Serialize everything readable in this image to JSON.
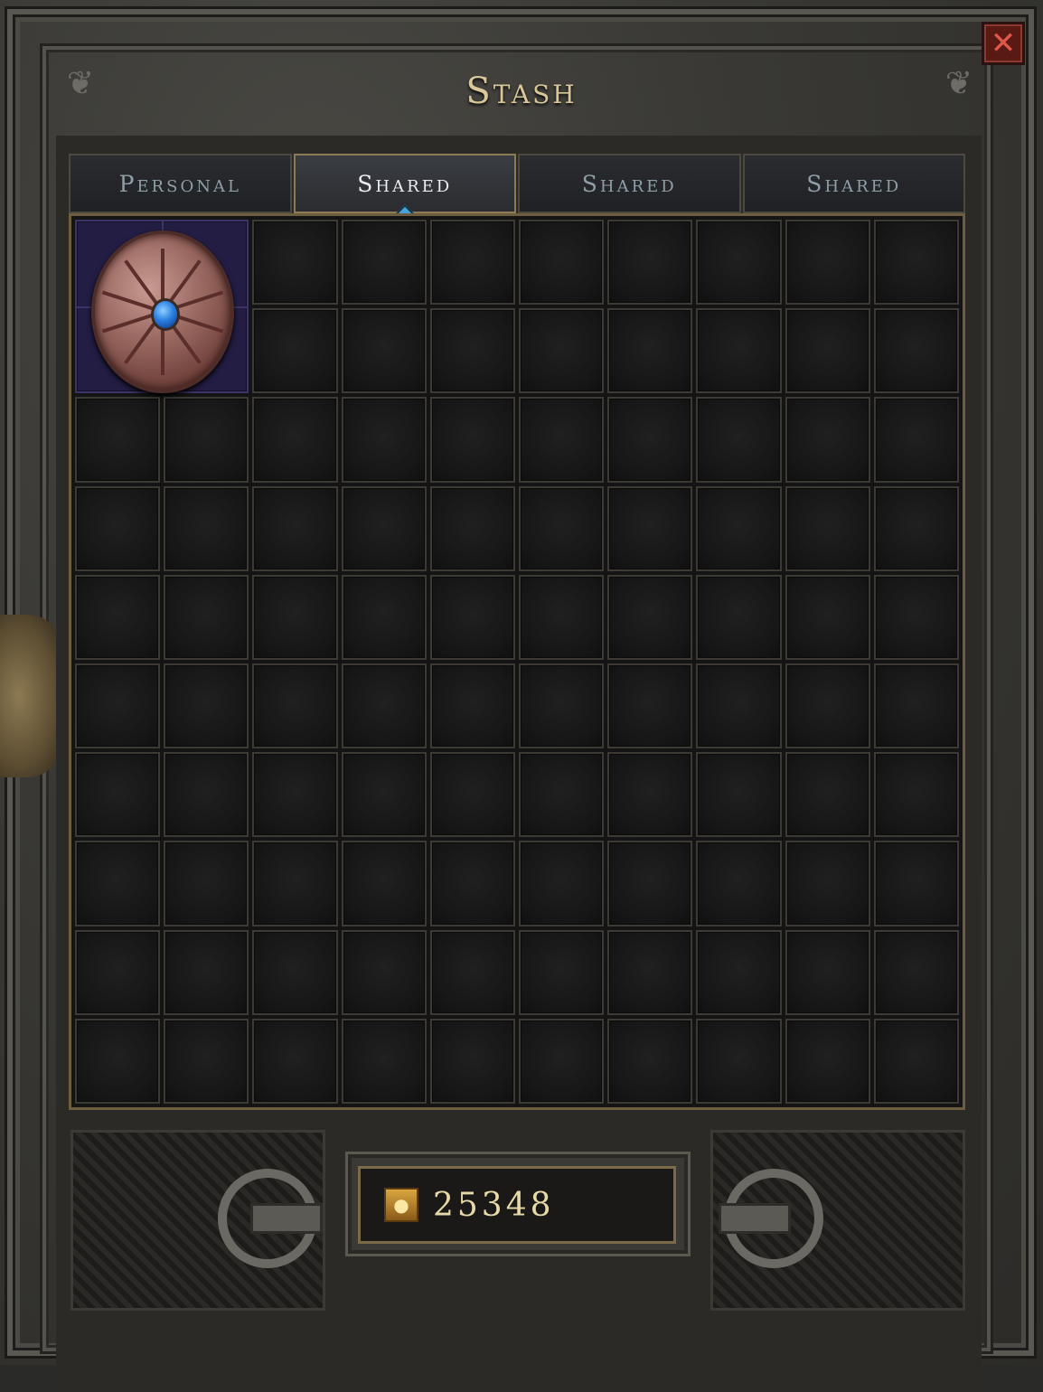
{
  "window": {
    "title": "Stash",
    "close_symbol": "✕"
  },
  "tabs": [
    {
      "label": "Personal",
      "active": false
    },
    {
      "label": "Shared",
      "active": true
    },
    {
      "label": "Shared",
      "active": false
    },
    {
      "label": "Shared",
      "active": false
    }
  ],
  "inventory": {
    "grid_columns": 10,
    "grid_rows": 10,
    "items": [
      {
        "name": "shield",
        "icon": "round-shield-with-blue-gem-icon",
        "column": 1,
        "row": 1,
        "width_cells": 2,
        "height_cells": 2,
        "border_color": "#3c3468"
      }
    ]
  },
  "gold": {
    "icon": "gold-coins-icon",
    "amount": "25348"
  },
  "colors": {
    "title": "#d9c79a",
    "tab_active_text": "#e8ecf0",
    "tab_inactive_text": "#8f9ea7",
    "item_background": "#231d44",
    "gold_text": "#e8d9a9",
    "close_button": "#5a1a14"
  }
}
